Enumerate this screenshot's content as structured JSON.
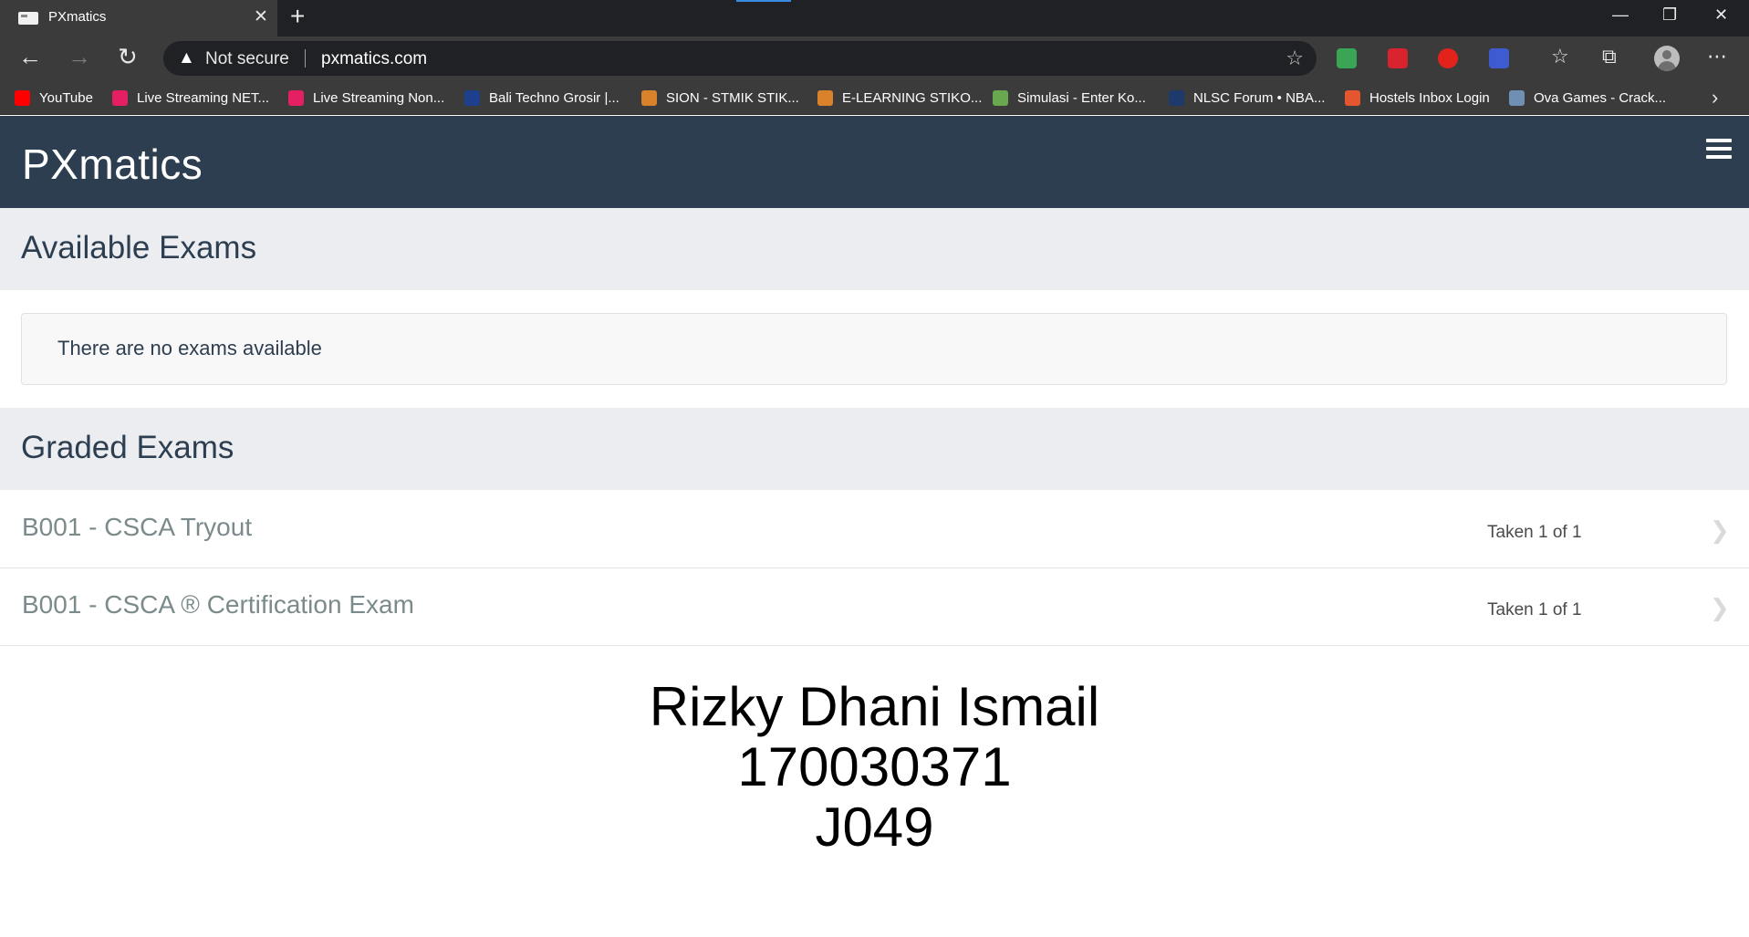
{
  "browser": {
    "tab_title": "PXmatics",
    "tab_close": "✕",
    "new_tab": "+",
    "window_controls": {
      "minimize": "—",
      "restore": "❐",
      "close": "✕"
    },
    "nav": {
      "back": "←",
      "forward": "→",
      "reload": "↻"
    },
    "address": {
      "security_icon": "warning-triangle-icon",
      "security_glyph": "▲",
      "security_label": "Not secure",
      "url": "pxmatics.com"
    },
    "toolbar_glyphs": {
      "add_favorite": "☆",
      "favorites": "☆",
      "collections": "⧉",
      "more": "⋯"
    },
    "extensions": [
      {
        "name": "extension-globe-icon",
        "color": "#3aa655"
      },
      {
        "name": "extension-download-icon",
        "color": "#d9232e"
      },
      {
        "name": "extension-adblock-icon",
        "color": "#e3231b"
      },
      {
        "name": "extension-puzzle-icon",
        "color": "#3e5bd1"
      }
    ],
    "bookmarks": [
      {
        "label": "YouTube",
        "color": "#ff0000"
      },
      {
        "label": "Live Streaming NET...",
        "color": "#e41f63"
      },
      {
        "label": "Live Streaming Non...",
        "color": "#e41f63"
      },
      {
        "label": "Bali Techno Grosir |...",
        "color": "#1d3f8e"
      },
      {
        "label": "SION - STMIK STIK...",
        "color": "#d9822b"
      },
      {
        "label": "E-LEARNING STIKO...",
        "color": "#d9822b"
      },
      {
        "label": "Simulasi - Enter Ko...",
        "color": "#6aa84f"
      },
      {
        "label": "NLSC Forum • NBA...",
        "color": "#1e3a6d"
      },
      {
        "label": "Hostels Inbox Login",
        "color": "#e4572e"
      },
      {
        "label": "Ova Games - Crack...",
        "color": "#6f8fb3"
      }
    ],
    "bookmarks_more": "›"
  },
  "site": {
    "brand": "PXmatics",
    "menu_icon": "hamburger-menu-icon"
  },
  "available": {
    "heading": "Available Exams",
    "empty_message": "There are no exams available"
  },
  "graded": {
    "heading": "Graded Exams",
    "exams": [
      {
        "title": "B001 - CSCA Tryout",
        "status": "Taken 1 of 1",
        "chevron": "❯"
      },
      {
        "title": "B001 - CSCA ® Certification Exam",
        "status": "Taken 1 of 1",
        "chevron": "❯"
      }
    ]
  },
  "identity": {
    "name": "Rizky Dhani Ismail",
    "student_id": "170030371",
    "code": "J049"
  }
}
